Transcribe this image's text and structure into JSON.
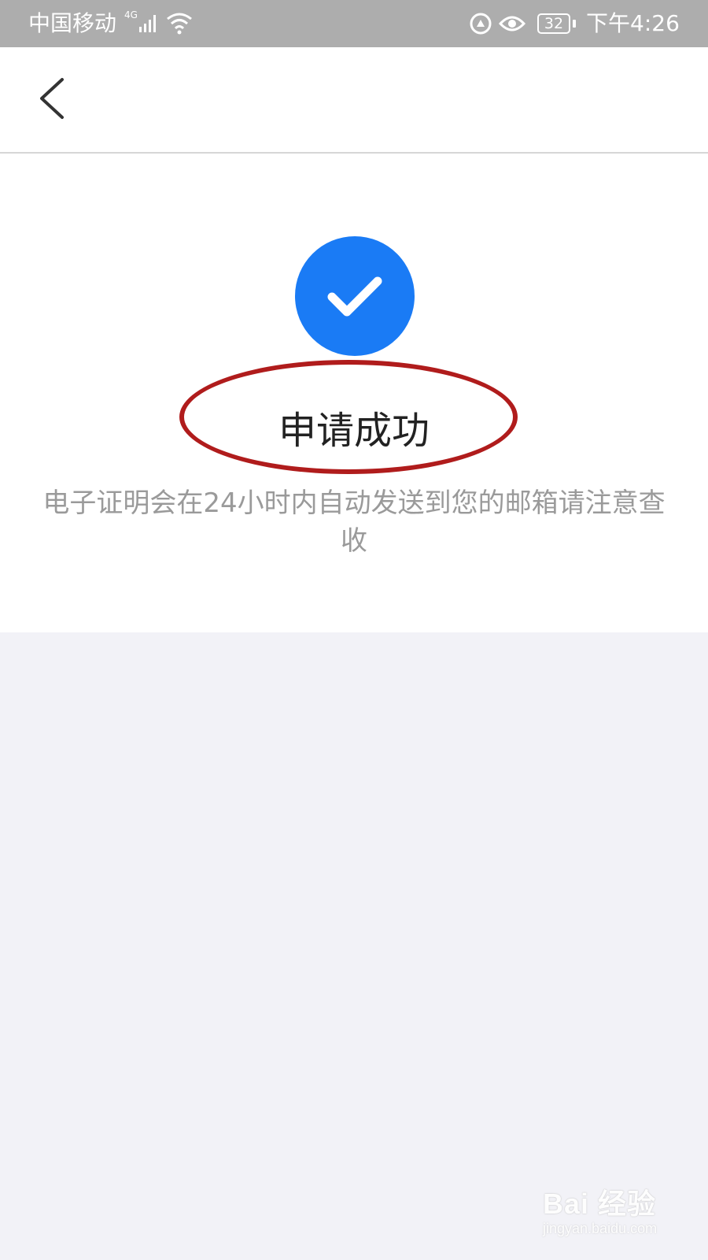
{
  "status_bar": {
    "carrier": "中国移动",
    "network": "4G",
    "battery": "32",
    "time": "下午4:26"
  },
  "nav": {
    "back_icon": "chevron-left-icon"
  },
  "success": {
    "icon": "check-icon",
    "title": "申请成功",
    "description": "电子证明会在24小时内自动发送到您的邮箱请注意查收"
  },
  "watermark": {
    "logo": "Bai 经验",
    "url": "jingyan.baidu.com"
  },
  "colors": {
    "accent": "#1a7bf5",
    "annotation": "#b01c1c",
    "status_bar": "#adadad",
    "page_bg": "#f2f2f7"
  }
}
